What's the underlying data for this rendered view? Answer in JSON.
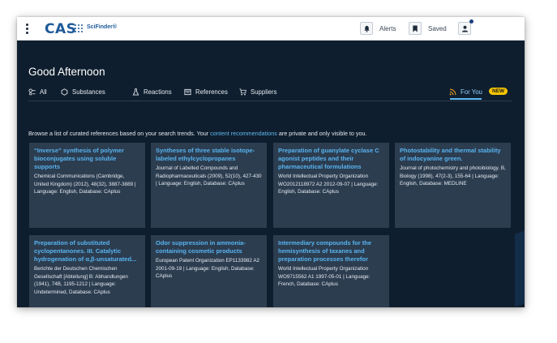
{
  "topbar": {
    "logo_text": "CAS",
    "product_name": "SciFinder®",
    "alerts_label": "Alerts",
    "saved_label": "Saved"
  },
  "greeting": "Good Afternoon",
  "tabs": [
    {
      "label": "All",
      "icon": "all-search-icon"
    },
    {
      "label": "Substances",
      "icon": "substance-icon"
    },
    {
      "label": "Reactions",
      "icon": "flask-icon"
    },
    {
      "label": "References",
      "icon": "reference-icon"
    },
    {
      "label": "Suppliers",
      "icon": "cart-icon"
    },
    {
      "label": "For You",
      "icon": "rss-icon",
      "active": true
    }
  ],
  "new_badge": "NEW",
  "intro": {
    "before": "Browse a list of curated references based on your search trends. Your ",
    "link": "content recommendations",
    "after": " are private and only visible to you."
  },
  "cards": [
    {
      "title": "“Inverse” synthesis of polymer bioconjugates using soluble supports",
      "body": "Chemical Communications (Cambridge, United Kingdom) (2012), 48(32), 3887-3889 | Language: English, Database: CAplus"
    },
    {
      "title": "Syntheses of three stable isotope-labeled ethylcyclopropanes",
      "body": "Journal of Labelled Compounds and Radiopharmaceuticals (2009), 52(10), 427-430 | Language: English, Database: CAplus"
    },
    {
      "title": "Preparation of guanylate cyclase C agonist peptides and their pharmaceutical formulations",
      "body": "World Intellectual Property Organization WO2012118972 A2 2012-09-07 | Language: English, Database: CAplus"
    },
    {
      "title": "Photostability and thermal stability of indocyanine green.",
      "body": "Journal of photochemistry and photobiology. B, Biology (1998), 47(2-3), 155-64 | Language: English, Database: MEDLINE"
    },
    {
      "title": "Preparation of substituted cyclopentanones. III. Catalytic hydrogenation of α,β-unsaturated...",
      "body": "Berichte der Deutschen Chemischen Gesellschaft [Abteilung] B: Abhandlungen (1941), 74B, 1195-1212 | Language: Undetermined, Database: CAplus"
    },
    {
      "title": "Odor suppression in ammonia-containing cosmetic products",
      "body": "European Patent Organization EP1133982 A2 2001-09-19 | Language: English, Database: CAplus"
    },
    {
      "title": "Intermediary compounds for the hemisynthesis of taxanes and preparation processes therefor",
      "body": "World Intellectual Property Organization WO9715562 A1 1997-05-01 | Language: French, Database: CAplus"
    }
  ],
  "colors": {
    "background": "#0f1e2e",
    "card": "#2c3d50",
    "card_title": "#58b4f0",
    "accent": "#5fb8f0",
    "badge": "#f5c400"
  }
}
